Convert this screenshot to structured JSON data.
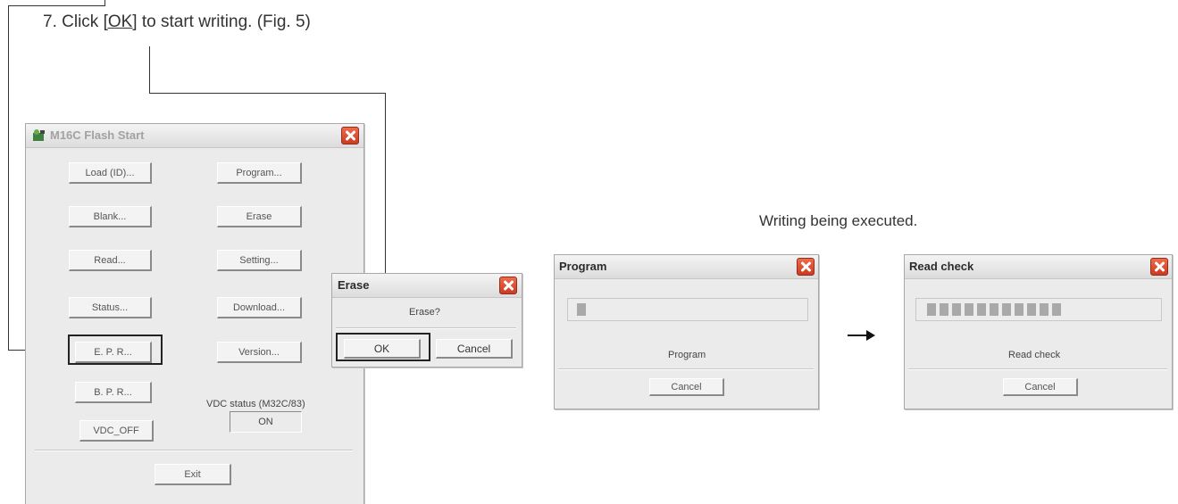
{
  "instruction": {
    "prefix": "7.  Click ",
    "ok": "[OK]",
    "suffix": " to start writing. (Fig. 5)"
  },
  "caption": "Writing being executed.",
  "flash_window": {
    "title": "M16C Flash Start",
    "buttons": {
      "load": "Load (ID)...",
      "program": "Program...",
      "blank": "Blank...",
      "erase": "Erase",
      "read": "Read...",
      "setting": "Setting...",
      "status": "Status...",
      "download": "Download...",
      "epr": "E. P. R...",
      "version": "Version...",
      "bpr": "B. P. R...",
      "vdc_off": "VDC_OFF",
      "exit": "Exit"
    },
    "vdc_label": "VDC status (M32C/83)",
    "vdc_value": "ON"
  },
  "erase_dialog": {
    "title": "Erase",
    "message": "Erase?",
    "ok": "OK",
    "cancel": "Cancel"
  },
  "program_dialog": {
    "title": "Program",
    "status": "Program",
    "cancel": "Cancel",
    "progress_blocks": 1
  },
  "readcheck_dialog": {
    "title": "Read check",
    "status": "Read check",
    "cancel": "Cancel",
    "progress_blocks": 11
  },
  "colors": {
    "close_button": "#e0502f",
    "progress_block": "#a9a9a9",
    "window_bg": "#ebebeb"
  }
}
